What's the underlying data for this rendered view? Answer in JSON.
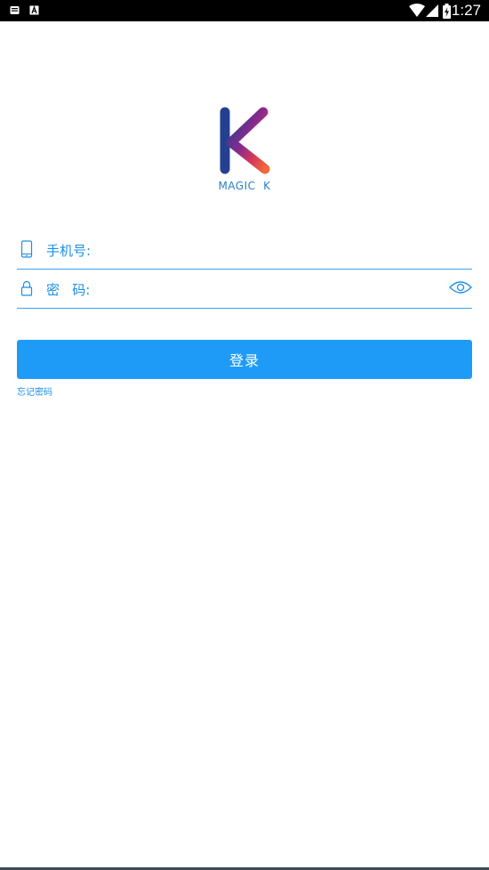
{
  "status_bar": {
    "time": "1:27",
    "left_icons": [
      "notification-icon",
      "text-a-icon"
    ],
    "right_icons": [
      "wifi-icon",
      "signal-icon",
      "battery-charging-icon"
    ]
  },
  "logo": {
    "text": "MAGIC  K"
  },
  "form": {
    "phone_label": "手机号:",
    "phone_value": "",
    "password_label": "密   码:",
    "password_value": "",
    "login_button": "登录",
    "forgot_password": "忘记密码"
  },
  "colors": {
    "accent": "#1e9bf7",
    "label": "#1a8fe8",
    "status_bar": "#000000",
    "background": "#ffffff"
  }
}
